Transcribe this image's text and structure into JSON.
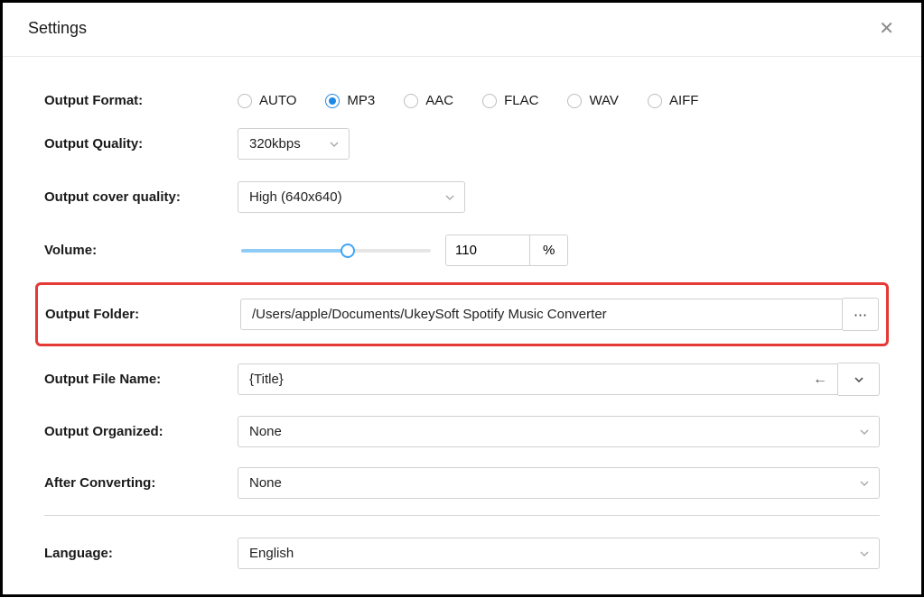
{
  "title": "Settings",
  "outputFormat": {
    "label": "Output Format:",
    "options": [
      "AUTO",
      "MP3",
      "AAC",
      "FLAC",
      "WAV",
      "AIFF"
    ],
    "selected": "MP3"
  },
  "outputQuality": {
    "label": "Output Quality:",
    "value": "320kbps"
  },
  "outputCoverQuality": {
    "label": "Output cover quality:",
    "value": "High (640x640)"
  },
  "volume": {
    "label": "Volume:",
    "value": "110",
    "unit": "%",
    "percent": 56
  },
  "outputFolder": {
    "label": "Output Folder:",
    "value": "/Users/apple/Documents/UkeySoft Spotify Music Converter"
  },
  "outputFileName": {
    "label": "Output File Name:",
    "value": "{Title}"
  },
  "outputOrganized": {
    "label": "Output Organized:",
    "value": "None"
  },
  "afterConverting": {
    "label": "After Converting:",
    "value": "None"
  },
  "language": {
    "label": "Language:",
    "value": "English"
  }
}
